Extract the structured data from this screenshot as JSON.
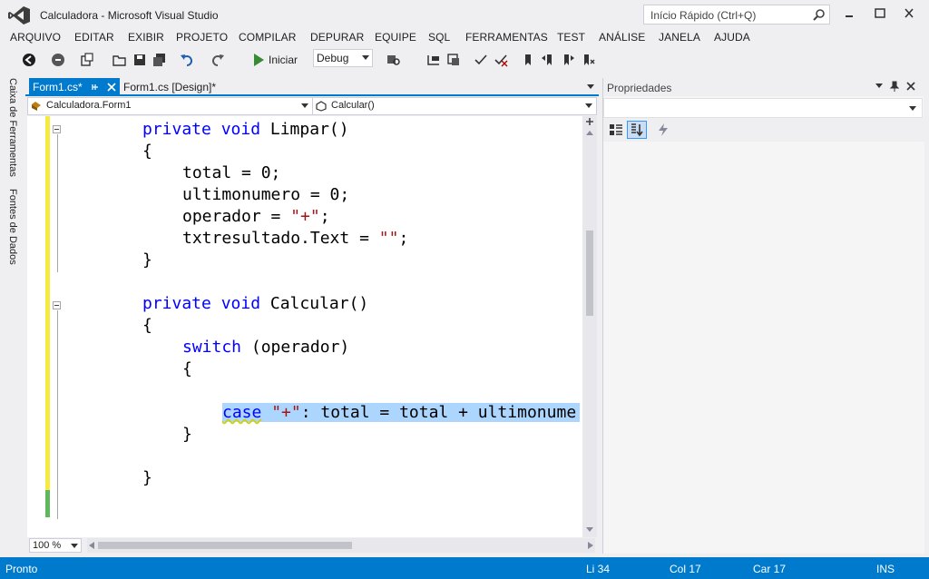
{
  "titlebar": {
    "title": "Calculadora - Microsoft Visual Studio",
    "quick_launch_placeholder": "Início Rápido (Ctrl+Q)"
  },
  "menu": [
    "ARQUIVO",
    "EDITAR",
    "EXIBIR",
    "PROJETO",
    "COMPILAR",
    "DEPURAR",
    "EQUIPE",
    "SQL",
    "FERRAMENTAS",
    "TEST",
    "ANÁLISE",
    "JANELA",
    "AJUDA"
  ],
  "toolbar": {
    "start_label": "Iniciar",
    "config_value": "Debug"
  },
  "side_tabs": [
    "Caixa de Ferramentas",
    "Fontes de Dados"
  ],
  "doc_tabs": {
    "active": "Form1.cs*",
    "inactive": "Form1.cs [Design]*"
  },
  "navbar": {
    "class_selector": "Calculadora.Form1",
    "member_selector": "Calcular()"
  },
  "code": {
    "l1_kw": "private void",
    "l1_rest": " Limpar()",
    "l2": "{",
    "l3": "total = 0;",
    "l4": "ultimonumero = 0;",
    "l5_a": "operador = ",
    "l5_str": "\"+\"",
    "l5_b": ";",
    "l6_a": "txtresultado.Text = ",
    "l6_str": "\"\"",
    "l6_b": ";",
    "l7": "}",
    "l9_kw": "private void",
    "l9_rest": " Calcular()",
    "l10": "{",
    "l11_kw": "switch",
    "l11_rest": " (operador)",
    "l12": "{",
    "l14_kw": "case",
    "l14_str": "\"+\"",
    "l14_rest": ": total = total + ultimonume",
    "l15": "}",
    "l17": "}"
  },
  "zoom": "100 %",
  "properties": {
    "title": "Propriedades"
  },
  "status": {
    "state": "Pronto",
    "line": "Li 34",
    "col": "Col 17",
    "car": "Car 17",
    "mode": "INS"
  }
}
